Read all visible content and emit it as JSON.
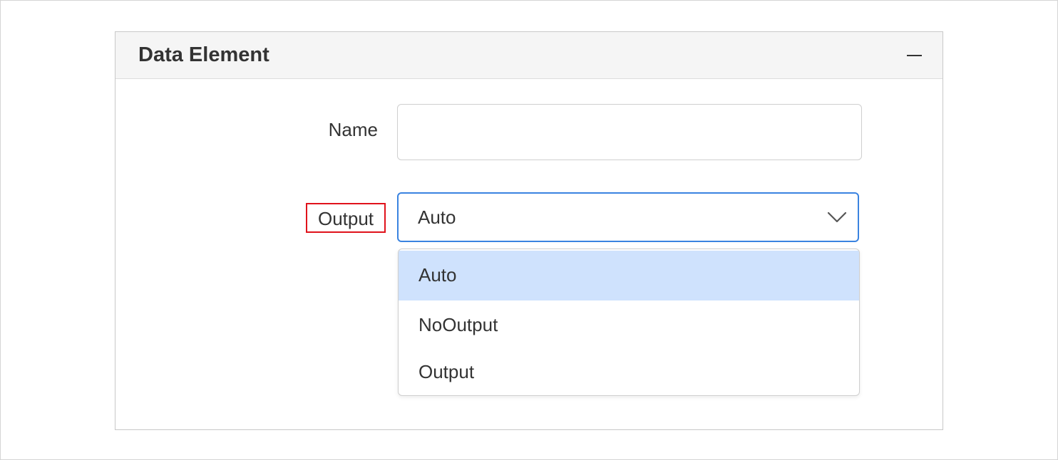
{
  "panel": {
    "title": "Data Element"
  },
  "fields": {
    "name": {
      "label": "Name",
      "value": "",
      "placeholder": ""
    },
    "output": {
      "label": "Output",
      "selected": "Auto",
      "options": [
        "Auto",
        "NoOutput",
        "Output"
      ]
    }
  },
  "colors": {
    "highlight_box": "#e0121b",
    "focus_border": "#3a83e0",
    "selected_option_bg": "#cfe2fd",
    "header_bg": "#f5f5f5"
  },
  "icons": {
    "collapse": "minus-icon",
    "dropdown": "chevron-down-icon"
  }
}
